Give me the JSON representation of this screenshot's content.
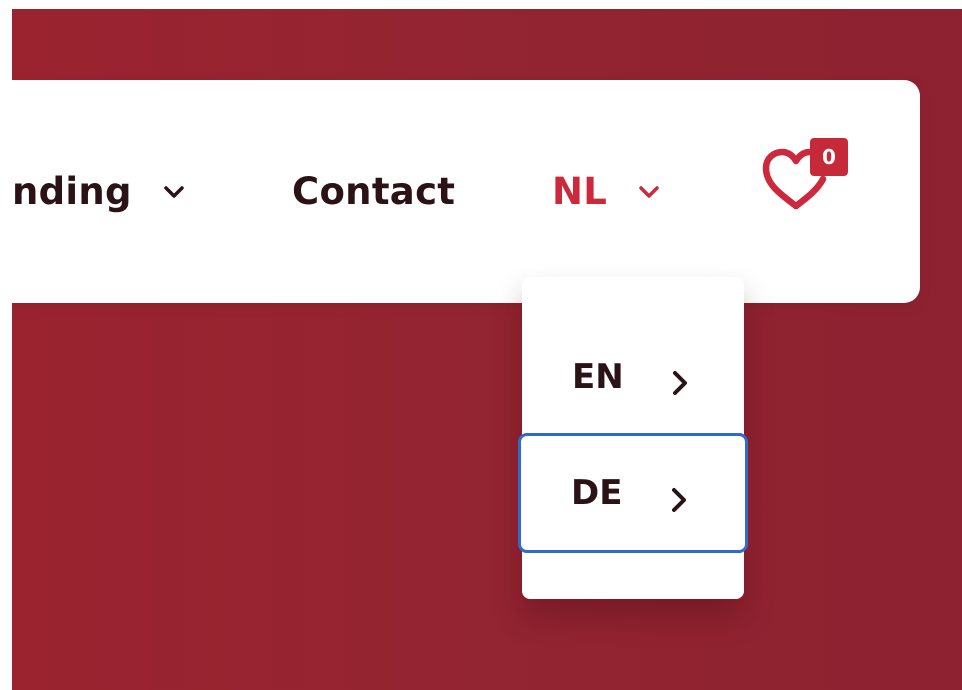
{
  "nav": {
    "partial_item_label": "nding",
    "contact_label": "Contact",
    "language_label": "NL"
  },
  "wishlist": {
    "count": "0"
  },
  "language_menu": {
    "items": [
      {
        "label": "EN"
      },
      {
        "label": "DE"
      }
    ]
  },
  "colors": {
    "background_red": "#932431",
    "accent_red": "#cc2a3c",
    "focus_blue": "#2f6cc9",
    "text_dark": "#2a1216"
  },
  "icons": {
    "dropdown": "chevron-down-icon",
    "submenu": "chevron-right-icon",
    "wishlist": "heart-icon"
  }
}
